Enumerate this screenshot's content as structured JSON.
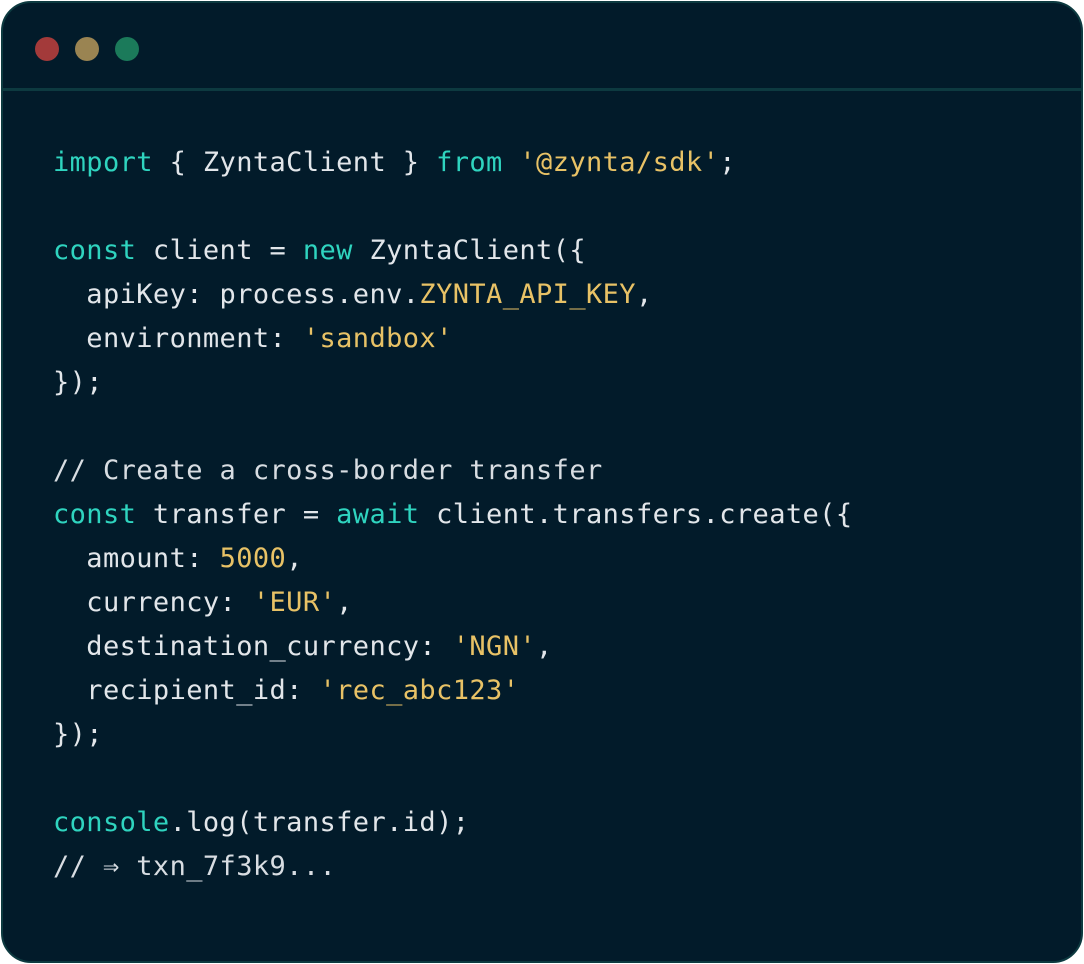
{
  "colors": {
    "window_bg": "#021b2a",
    "window_border": "#0d3a40",
    "dot_red": "#a33a3a",
    "dot_yellow": "#9a8452",
    "dot_green": "#1b7a5a",
    "keyword": "#2fd4bf",
    "string": "#e8c266",
    "text": "#e2e6ea"
  },
  "window_controls": [
    {
      "name": "close",
      "color": "#a33a3a"
    },
    {
      "name": "minimize",
      "color": "#9a8452"
    },
    {
      "name": "maximize",
      "color": "#1b7a5a"
    }
  ],
  "code_lines": [
    [
      {
        "t": "kw",
        "v": "import"
      },
      {
        "t": "plain",
        "v": " { ZyntaClient } "
      },
      {
        "t": "kw",
        "v": "from"
      },
      {
        "t": "plain",
        "v": " "
      },
      {
        "t": "str",
        "v": "'@zynta/sdk'"
      },
      {
        "t": "plain",
        "v": ";"
      }
    ],
    [],
    [
      {
        "t": "kw",
        "v": "const"
      },
      {
        "t": "plain",
        "v": " client = "
      },
      {
        "t": "kw",
        "v": "new"
      },
      {
        "t": "plain",
        "v": " ZyntaClient({"
      }
    ],
    [
      {
        "t": "plain",
        "v": "  apiKey: process.env."
      },
      {
        "t": "env",
        "v": "ZYNTA_API_KEY"
      },
      {
        "t": "plain",
        "v": ","
      }
    ],
    [
      {
        "t": "plain",
        "v": "  environment: "
      },
      {
        "t": "str",
        "v": "'sandbox'"
      }
    ],
    [
      {
        "t": "plain",
        "v": "});"
      }
    ],
    [],
    [
      {
        "t": "comment",
        "v": "// Create a cross-border transfer"
      }
    ],
    [
      {
        "t": "kw",
        "v": "const"
      },
      {
        "t": "plain",
        "v": " transfer = "
      },
      {
        "t": "kw",
        "v": "await"
      },
      {
        "t": "plain",
        "v": " client.transfers.create({"
      }
    ],
    [
      {
        "t": "plain",
        "v": "  amount: "
      },
      {
        "t": "num",
        "v": "5000"
      },
      {
        "t": "plain",
        "v": ","
      }
    ],
    [
      {
        "t": "plain",
        "v": "  currency: "
      },
      {
        "t": "str",
        "v": "'EUR'"
      },
      {
        "t": "plain",
        "v": ","
      }
    ],
    [
      {
        "t": "plain",
        "v": "  destination_currency: "
      },
      {
        "t": "str",
        "v": "'NGN'"
      },
      {
        "t": "plain",
        "v": ","
      }
    ],
    [
      {
        "t": "plain",
        "v": "  recipient_id: "
      },
      {
        "t": "str",
        "v": "'rec_abc123'"
      }
    ],
    [
      {
        "t": "plain",
        "v": "});"
      }
    ],
    [],
    [
      {
        "t": "kw",
        "v": "console"
      },
      {
        "t": "plain",
        "v": ".log(transfer.id);"
      }
    ],
    [
      {
        "t": "comment",
        "v": "// ⇒ txn_7f3k9..."
      }
    ]
  ]
}
